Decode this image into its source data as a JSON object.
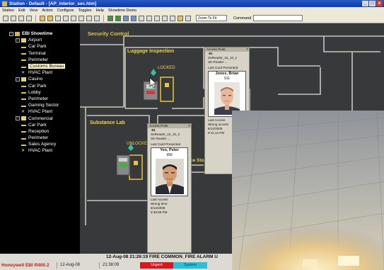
{
  "window": {
    "title": "Station - Default - [AP_interior_sec.htm]",
    "min": "_",
    "max": "□",
    "close": "x"
  },
  "menu": [
    "Station",
    "Edit",
    "View",
    "Action",
    "Configure",
    "Toggles",
    "Help",
    "Showtime Demo"
  ],
  "toolbar": {
    "zoom": "Zoom To Fit",
    "command_label": "Command"
  },
  "tree": {
    "root": "EBI Showtime",
    "items": [
      {
        "label": "Airport",
        "level": 1,
        "kind": "bldg",
        "exp": "−"
      },
      {
        "label": "Car Park",
        "level": 2,
        "kind": "key"
      },
      {
        "label": "Terminal",
        "level": 2,
        "kind": "key"
      },
      {
        "label": "Perimeter",
        "level": 2,
        "kind": "key"
      },
      {
        "label": "Customs Bureau",
        "level": 2,
        "kind": "key",
        "selected": true
      },
      {
        "label": "HVAC Plant",
        "level": 2,
        "kind": "fan"
      },
      {
        "label": "Casino",
        "level": 1,
        "kind": "bldg",
        "exp": "−"
      },
      {
        "label": "Car Park",
        "level": 2,
        "kind": "key"
      },
      {
        "label": "Lobby",
        "level": 2,
        "kind": "key"
      },
      {
        "label": "Perimeter",
        "level": 2,
        "kind": "key"
      },
      {
        "label": "Gaming Sector",
        "level": 2,
        "kind": "key"
      },
      {
        "label": "HVAC Plant",
        "level": 2,
        "kind": "fan"
      },
      {
        "label": "Commercial",
        "level": 1,
        "kind": "bldg",
        "exp": "−"
      },
      {
        "label": "Car Park",
        "level": 2,
        "kind": "key"
      },
      {
        "label": "Reception",
        "level": 2,
        "kind": "key"
      },
      {
        "label": "Perimeter",
        "level": 2,
        "kind": "key"
      },
      {
        "label": "Sales Agency",
        "level": 2,
        "kind": "key"
      },
      {
        "label": "HVAC Plant",
        "level": 2,
        "kind": "fan"
      }
    ]
  },
  "map": {
    "title": "Security Control",
    "rooms": {
      "luggage": "Luggage Inspection",
      "substance": "Substance Lab",
      "storage": "nce Storage"
    },
    "status_locked": "LOCKED",
    "status_unlocked": "UNLOCKE"
  },
  "panel1": {
    "head": "Access Point",
    "reader_id": "-81",
    "reader": "SeReader_10_10_1",
    "reader_type": "SE Reader ...",
    "last_card_label": "Last Card Presented",
    "name": "Jones, Brian",
    "card_no": "911",
    "last_access_label": "Last Access",
    "result": "Wrong access",
    "date": "8/12/2008",
    "time": "9:11:14 PM"
  },
  "panel2": {
    "head": "Access Point",
    "reader_id": "-81",
    "reader": "SeReader_10_10_2",
    "reader_type": "SE Reader ...",
    "last_card_label": "Last Card Presented",
    "name": "Yen, Peter",
    "card_no": "999",
    "last_access_label": "Last Access",
    "result": "Wrong time",
    "date": "8/12/2008",
    "time": "9:30:59 PM"
  },
  "status": {
    "alarm_text": "12-Aug-08   21:26:19   FIRE   COMMON_FIRE   ALARM   U",
    "brand": "Honeywell EBI R400.2",
    "date": "12-Aug-08",
    "time": "21:38:09",
    "urgent": "Urgent",
    "system": "System"
  },
  "colors": {
    "map_bg": "#38393a",
    "room_label": "#f2d44a",
    "urgent": "#e0141a",
    "system": "#23c3df",
    "brand": "#cc1b1b"
  }
}
